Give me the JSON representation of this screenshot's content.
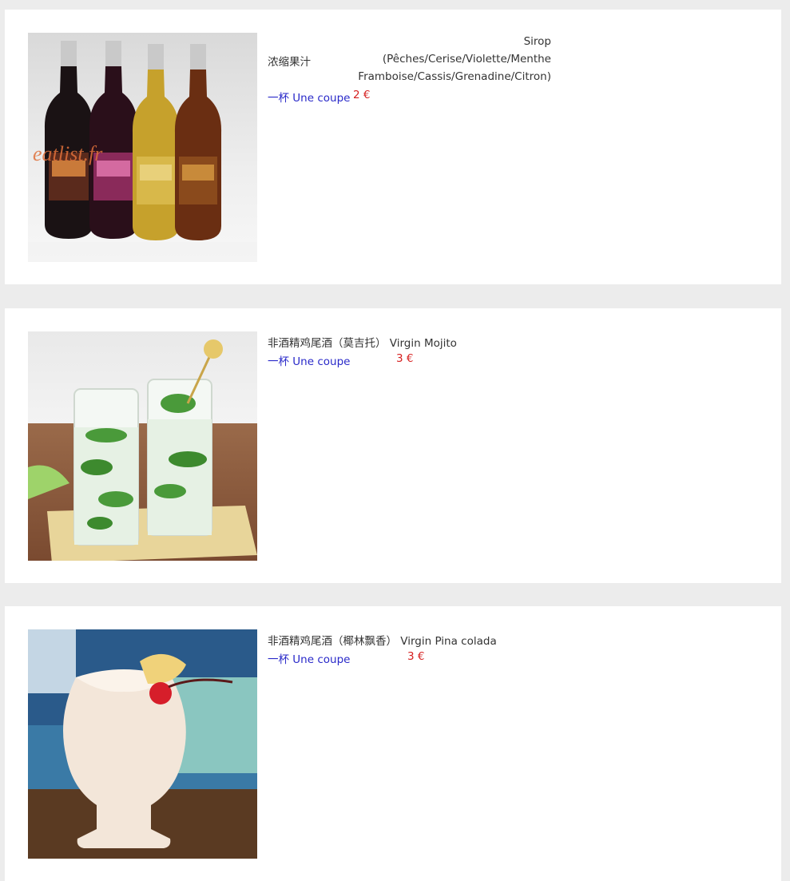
{
  "items": [
    {
      "name_cn": "浓缩果汁",
      "name_fr_lines": [
        "Sirop",
        "(Pêches/Cerise/Violette/Menthe",
        "Framboise/Cassis/Grenadine/Citron)"
      ],
      "cup_label": "一杯 Une coupe",
      "price": "2 €",
      "watermark": "eatlist.fr"
    },
    {
      "name": "非酒精鸡尾酒（莫吉托） Virgin Mojito",
      "cup_label": "一杯 Une coupe",
      "price": "3 €"
    },
    {
      "name": "非酒精鸡尾酒（椰林飘香） Virgin Pina colada",
      "cup_label": "一杯 Une coupe",
      "price": "3 €"
    }
  ]
}
